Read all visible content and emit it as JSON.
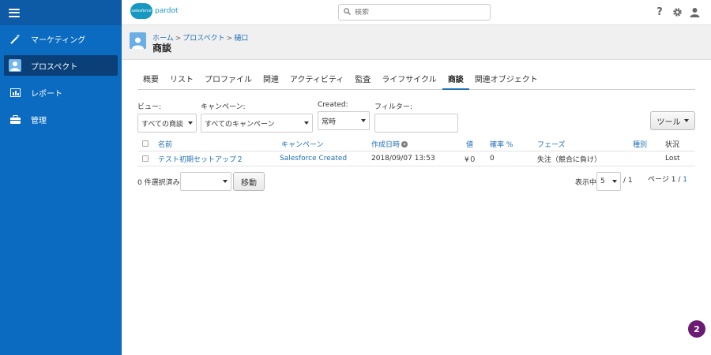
{
  "topbar": {
    "logo_cloud": "salesforce",
    "logo_text": "pardot",
    "search_placeholder": "検索"
  },
  "sidebar": {
    "items": [
      {
        "label": "マーケティング",
        "icon": "magic-wand-icon"
      },
      {
        "label": "プロスペクト",
        "icon": "prospect-icon"
      },
      {
        "label": "レポート",
        "icon": "report-icon"
      },
      {
        "label": "管理",
        "icon": "briefcase-icon"
      }
    ]
  },
  "header": {
    "breadcrumb": [
      "ホーム",
      "プロスペクト",
      "樋口"
    ],
    "title": "商談"
  },
  "tabs": [
    "概要",
    "リスト",
    "プロファイル",
    "関連",
    "アクティビティ",
    "監査",
    "ライフサイクル",
    "商談",
    "関連オブジェクト"
  ],
  "filters": {
    "view_label": "ビュー:",
    "view_value": "すべての商談",
    "campaign_label": "キャンペーン:",
    "campaign_value": "すべてのキャンペーン",
    "created_label": "Created:",
    "created_value": "常時",
    "filter_label": "フィルター:",
    "filter_value": ""
  },
  "tools_label": "ツール",
  "table": {
    "headers": {
      "name": "名前",
      "campaign": "キャンペーン",
      "created": "作成日時",
      "value": "値",
      "probability": "確率 %",
      "phase": "フェーズ",
      "type": "種別",
      "status": "状況"
    },
    "rows": [
      {
        "name": "テスト初期セットアップ２",
        "campaign": "Salesforce Created",
        "created": "2018/09/07 13:53",
        "value": "¥０",
        "probability": "0",
        "phase": "失注（競合に負け）",
        "type": "",
        "status": "Lost"
      }
    ]
  },
  "footer": {
    "selected_label": "0 件選択済み:",
    "move_label": "移動",
    "show_label": "表示中",
    "per_page": "5",
    "per_page_total": "/ 1",
    "page_label": "ページ",
    "page_current": "1",
    "page_sep": "/",
    "page_total": "1"
  },
  "badge_count": "2",
  "colors": {
    "sidebar": "#0a6bc1",
    "sidebar_active": "#0a3f78",
    "link": "#1f6fb7",
    "badge": "#6a1b72"
  }
}
